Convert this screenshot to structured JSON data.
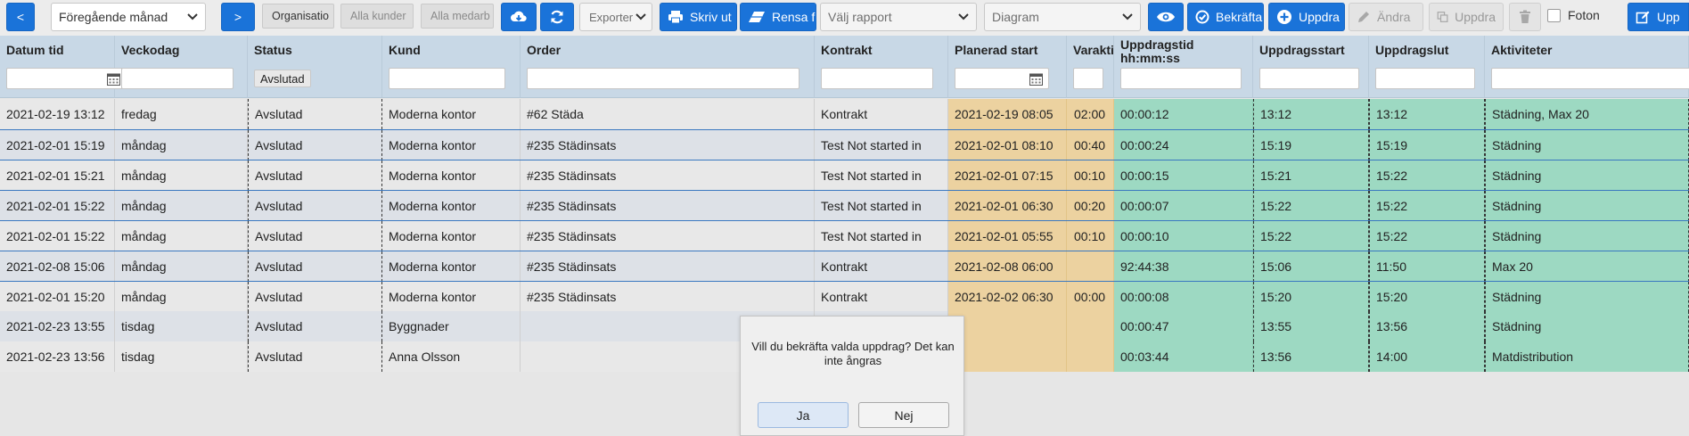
{
  "toolbar": {
    "prev_label": "<",
    "period_select": "Föregående månad",
    "next_label": ">",
    "org_chip": "Organisatio",
    "customers_chip": "Alla kunder",
    "employees_chip": "Alla medarb",
    "export_select": "Exporter",
    "print_label": "Skriv ut",
    "clear_label": "Rensa f",
    "report_select": "Välj rapport",
    "diagram_select": "Diagram",
    "confirm_label": "Bekräfta",
    "new_label": "Uppdra",
    "edit_label": "Ändra",
    "copy_label": "Uppdra",
    "photo_label": "Foton",
    "last_label": "Upp"
  },
  "columns": [
    {
      "title": "Datum tid"
    },
    {
      "title": "Veckodag"
    },
    {
      "title": "Status"
    },
    {
      "title": "Kund"
    },
    {
      "title": "Order"
    },
    {
      "title": "Kontrakt"
    },
    {
      "title": "Planerad start"
    },
    {
      "title": "Varakti"
    },
    {
      "title": "Uppdragstid\nhh:mm:ss"
    },
    {
      "title": "Uppdragsstart"
    },
    {
      "title": "Uppdragslut"
    },
    {
      "title": "Aktiviteter"
    }
  ],
  "filters": {
    "status": "Avslutad"
  },
  "rows": [
    [
      "2021-02-19 13:12",
      "fredag",
      "Avslutad",
      "Moderna kontor",
      "#62 Städa",
      "Kontrakt",
      "2021-02-19 08:05",
      "02:00",
      "00:00:12",
      "13:12",
      "13:12",
      "Städning, Max 20"
    ],
    [
      "2021-02-01 15:19",
      "måndag",
      "Avslutad",
      "Moderna kontor",
      "#235 Städinsats",
      "Test Not started in",
      "2021-02-01 08:10",
      "00:40",
      "00:00:24",
      "15:19",
      "15:19",
      "Städning"
    ],
    [
      "2021-02-01 15:21",
      "måndag",
      "Avslutad",
      "Moderna kontor",
      "#235 Städinsats",
      "Test Not started in",
      "2021-02-01 07:15",
      "00:10",
      "00:00:15",
      "15:21",
      "15:22",
      "Städning"
    ],
    [
      "2021-02-01 15:22",
      "måndag",
      "Avslutad",
      "Moderna kontor",
      "#235 Städinsats",
      "Test Not started in",
      "2021-02-01 06:30",
      "00:20",
      "00:00:07",
      "15:22",
      "15:22",
      "Städning"
    ],
    [
      "2021-02-01 15:22",
      "måndag",
      "Avslutad",
      "Moderna kontor",
      "#235 Städinsats",
      "Test Not started in",
      "2021-02-01 05:55",
      "00:10",
      "00:00:10",
      "15:22",
      "15:22",
      "Städning"
    ],
    [
      "2021-02-08 15:06",
      "måndag",
      "Avslutad",
      "Moderna kontor",
      "#235 Städinsats",
      "Kontrakt",
      "2021-02-08 06:00",
      "",
      "92:44:38",
      "15:06",
      "11:50",
      "Max 20"
    ],
    [
      "2021-02-01 15:20",
      "måndag",
      "Avslutad",
      "Moderna kontor",
      "#235 Städinsats",
      "Kontrakt",
      "2021-02-02 06:30",
      "00:00",
      "00:00:08",
      "15:20",
      "15:20",
      "Städning"
    ],
    [
      "2021-02-23 13:55",
      "tisdag",
      "Avslutad",
      "Byggnader",
      "",
      "",
      "",
      "",
      "00:00:47",
      "13:55",
      "13:56",
      "Städning"
    ],
    [
      "2021-02-23 13:56",
      "tisdag",
      "Avslutad",
      "Anna Olsson",
      "",
      "",
      "",
      "",
      "00:03:44",
      "13:56",
      "14:00",
      "Matdistribution"
    ]
  ],
  "dialog": {
    "message": "Vill du bekräfta valda uppdrag? Det kan inte ångras",
    "yes": "Ja",
    "no": "Nej"
  },
  "colors": {
    "accent": "#1a73d9",
    "header_bg": "#c8d8e6",
    "planned_bg": "#ecd2a0",
    "done_bg": "#9dd9c2"
  }
}
